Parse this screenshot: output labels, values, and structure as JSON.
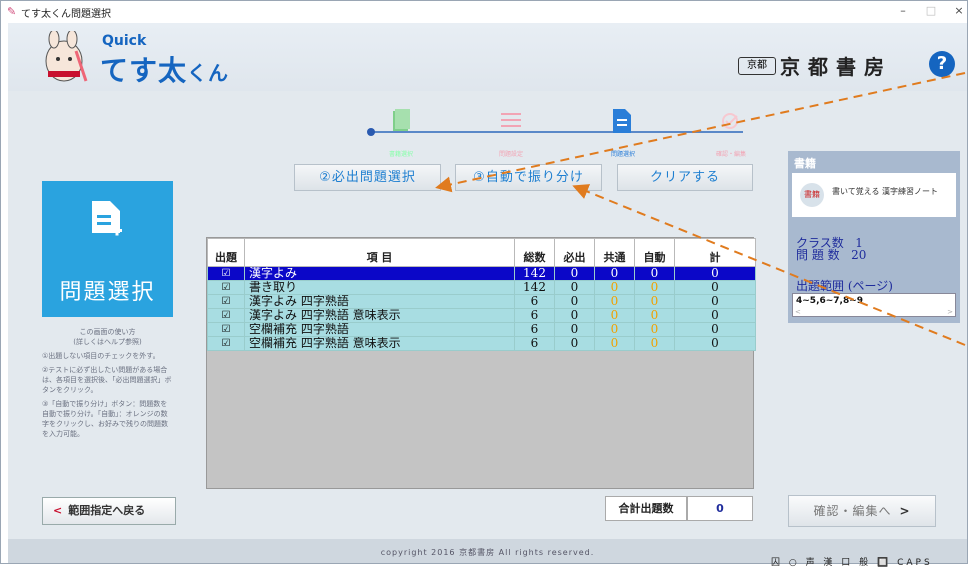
{
  "window": {
    "title": "てす太くん問題選択",
    "minimize": "–",
    "maximize": "□",
    "close": "×"
  },
  "header": {
    "quick": "Quick",
    "app_name": "てす太",
    "app_name_suffix": "くん",
    "publisher_mark": "京都",
    "publisher_name": "京都書房",
    "help": "?"
  },
  "steps": [
    {
      "label": "書籍選択",
      "icon": "book-icon"
    },
    {
      "label": "問題設定",
      "icon": "list-icon"
    },
    {
      "label": "問題選択",
      "icon": "document-add-icon"
    },
    {
      "label": "確認・編集",
      "icon": "check-edit-icon"
    }
  ],
  "toolbar": {
    "required_select": "②必出問題選択",
    "auto_distribute": "③自動で振り分け",
    "clear": "クリアする"
  },
  "page_card": {
    "label": "問題選択",
    "icon": "document-add-icon"
  },
  "howto": {
    "title": "この画面の使い方",
    "subtitle": "(詳しくはヘルプ参照)",
    "tip1": "①出題しない項目のチェックを外す。",
    "tip2": "②テストに必ず出したい問題がある場合は、各項目を選択後、「必出問題選択」ボタンをクリック。",
    "tip3": "③「自動で振り分け」ボタン：問題数を自動で振り分け。「自動」：オレンジの数字をクリックし、お好みで残りの問題数を入力可能。"
  },
  "table": {
    "headers": {
      "check": "出題",
      "item": "項 目",
      "total": "総数",
      "required": "必出",
      "common": "共通",
      "auto": "自動",
      "sum": "計"
    },
    "rows": [
      {
        "check": "☑",
        "item": "漢字よみ",
        "total": "142",
        "required": "0",
        "common": "0",
        "auto": "0",
        "sum": "0"
      },
      {
        "check": "☑",
        "item": "書き取り",
        "total": "142",
        "required": "0",
        "common": "0",
        "auto": "0",
        "sum": "0"
      },
      {
        "check": "☑",
        "item": "漢字よみ 四字熟語",
        "total": "6",
        "required": "0",
        "common": "0",
        "auto": "0",
        "sum": "0"
      },
      {
        "check": "☑",
        "item": "漢字よみ 四字熟語 意味表示",
        "total": "6",
        "required": "0",
        "common": "0",
        "auto": "0",
        "sum": "0"
      },
      {
        "check": "☑",
        "item": "空欄補充 四字熟語",
        "total": "6",
        "required": "0",
        "common": "0",
        "auto": "0",
        "sum": "0"
      },
      {
        "check": "☑",
        "item": "空欄補充 四字熟語 意味表示",
        "total": "6",
        "required": "0",
        "common": "0",
        "auto": "0",
        "sum": "0"
      }
    ]
  },
  "side": {
    "title": "書籍",
    "book_name": "書いて覚える 漢字練習ノート",
    "book_icon_text": "書籍",
    "class_label": "クラス数",
    "class_value": "1",
    "question_label": "問 題 数",
    "question_value": "20",
    "range_label": "出題範囲 (ページ)",
    "range_value": "4~5,6~7,8~9"
  },
  "bottom": {
    "back": "範囲指定へ戻る",
    "total_label": "合計出題数",
    "total_value": "0",
    "next": "確認・編集へ"
  },
  "footer": {
    "copyright": "copyright 2016 京都書房  All rights reserved.",
    "tray": "囚 ○ 声 漢 口 般 🔲 CAPS"
  },
  "colors": {
    "accent": "#1565c0",
    "card": "#2aa3df",
    "selected_row": "#0b07c8",
    "row": "#a8dde2",
    "auto_value": "#f0a000",
    "annotation_arrow": "#e07b1e"
  }
}
